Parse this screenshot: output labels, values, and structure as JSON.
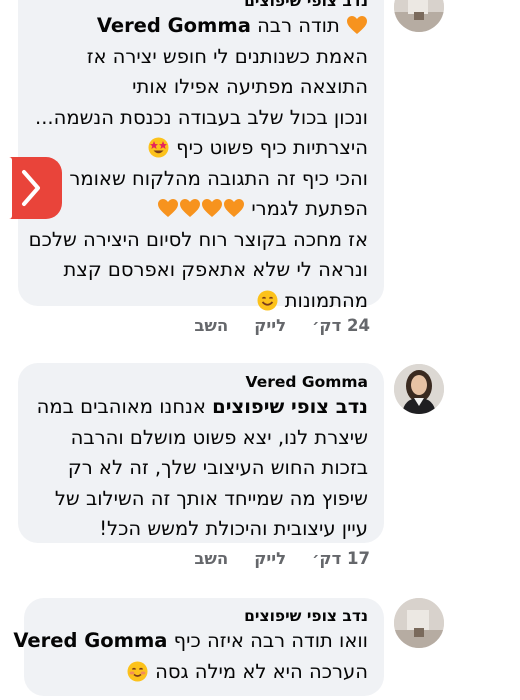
{
  "comments": [
    {
      "author": "נדב צופי שיפוצים",
      "lines": [
        "תודה רבה",
        "האמת כשנותנים לי חופש יצירה אז",
        "התוצאה מפתיעה אפילו אותי",
        "ונכון בכול שלב בעבודה נכנסת הנשמה...",
        "היצרתיות כיף פשוט כיף",
        "והכי כיף זה התגובה מהלקוח שאומר וו",
        "הפתעת לגמרי",
        "אז מחכה בקוצר רוח לסיום היצירה שלכם",
        "ונראה לי שלא אתאפק ואפרסם קצת",
        "מהתמונות"
      ],
      "tag": "Vered Gomma",
      "time": "24 דק׳",
      "like": "לייק",
      "reply": "השב"
    },
    {
      "author": "Vered Gomma",
      "tag": "נדב צופי שיפוצים",
      "lines": [
        "אנחנו מאוהבים במה",
        "שיצרת לנו, יצא פשוט מושלם והרבה",
        "בזכות החוש העיצובי שלך, זה לא רק",
        "שיפוץ מה שמייחד אותך זה השילוב של",
        "עיין עיצובית והיכולת למשש הכל!"
      ],
      "time": "17 דק׳",
      "like": "לייק",
      "reply": "השב"
    },
    {
      "author": "נדב צופי שיפוצים",
      "tag": "Vered Gomma",
      "lines": [
        "וואו תודה רבה איזה כיף",
        "הערכה היא לא מילה גסה"
      ]
    }
  ],
  "icons": {
    "heart": "orange-heart-icon",
    "star_eyes": "star-struck-emoji-icon",
    "smile": "smiling-face-emoji-icon",
    "blush": "blushing-face-emoji-icon",
    "side_tab": "chevron-right-icon"
  },
  "colors": {
    "bubble_bg": "#f0f2f5",
    "meta_text": "#65676b",
    "side_tab": "#e9443a",
    "heart": "#f7931e"
  }
}
